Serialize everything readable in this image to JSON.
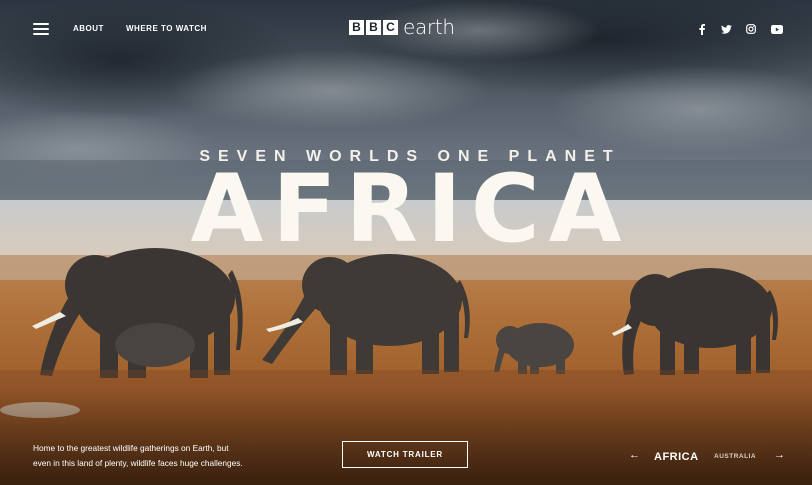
{
  "brand": {
    "logo_letters": [
      "B",
      "B",
      "C"
    ],
    "logo_word": "earth"
  },
  "nav": {
    "menu_icon": "hamburger-menu-icon",
    "links": [
      {
        "label": "ABOUT"
      },
      {
        "label": "WHERE TO WATCH"
      }
    ]
  },
  "social": [
    {
      "icon": "facebook-icon"
    },
    {
      "icon": "twitter-icon"
    },
    {
      "icon": "instagram-icon"
    },
    {
      "icon": "youtube-icon"
    }
  ],
  "hero": {
    "kicker": "SEVEN WORLDS ONE PLANET",
    "headline": "AFRICA",
    "background": "elephant-herd-savanna-photo",
    "description_lines": [
      "Home to the greatest wildlife gatherings on Earth, but",
      "even in this land of plenty, wildlife faces huge challenges."
    ],
    "cta_label": "WATCH TRAILER"
  },
  "region_nav": {
    "prev_icon": "arrow-left-icon",
    "current": "AFRICA",
    "next": "AUSTRALIA",
    "next_icon": "arrow-right-icon"
  },
  "colors": {
    "sky": "#2c3a48",
    "haze": "#c9bfb0",
    "grass": "#a4662f",
    "text": "#ffffff"
  }
}
